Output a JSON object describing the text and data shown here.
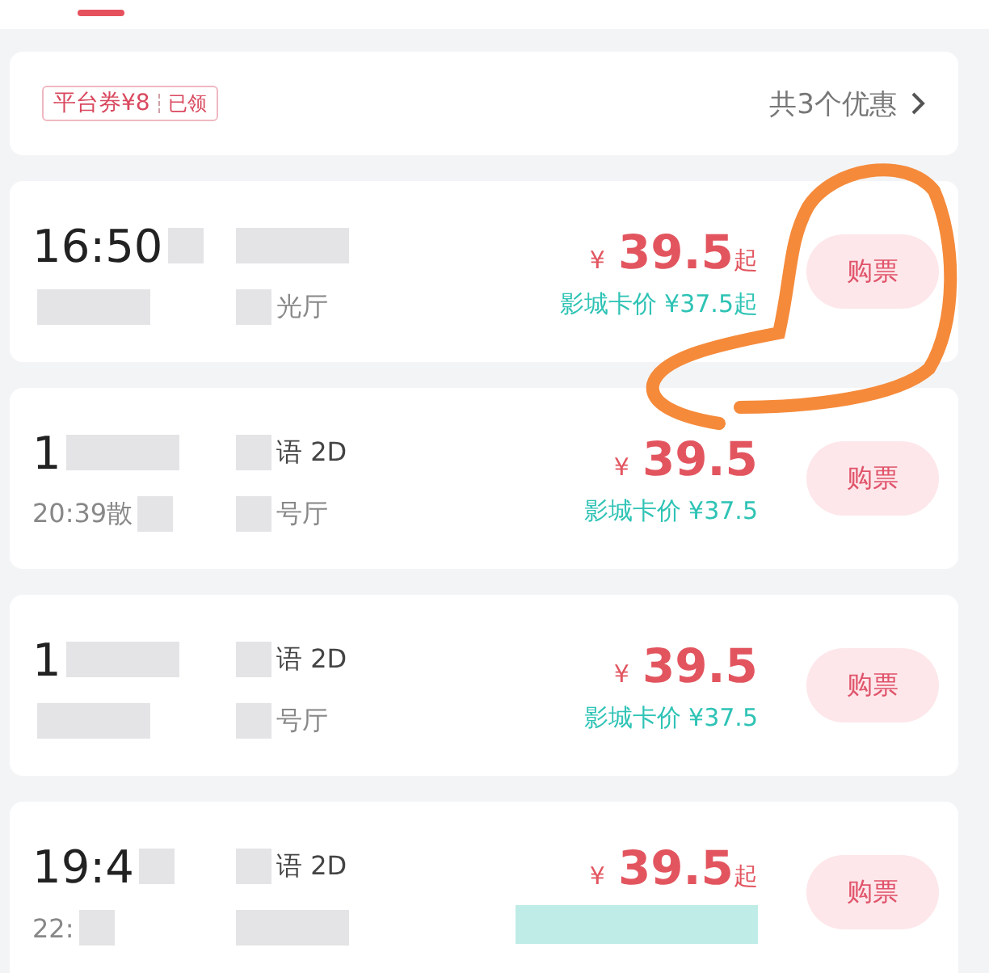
{
  "coupon_bar": {
    "coupon": "平台券¥8",
    "coupon_status": "已领",
    "offers_link": "共3个优惠"
  },
  "showtimes": [
    {
      "start": "16:50",
      "hall": "光厅",
      "currency": "¥",
      "price": "39.5",
      "price_suffix": "起",
      "card_price": "影城卡价 ¥37.5起",
      "button": "购票"
    },
    {
      "start": "1",
      "end": "20:39散",
      "format": "语 2D",
      "hall": "号厅",
      "currency": "¥",
      "price": "39.5",
      "card_price": "影城卡价 ¥37.5",
      "button": "购票"
    },
    {
      "start": "1",
      "format": "语 2D",
      "hall": "号厅",
      "currency": "¥",
      "price": "39.5",
      "card_price": "影城卡价 ¥37.5",
      "button": "购票"
    },
    {
      "start": "19:4",
      "end": "22:",
      "format": "语 2D",
      "currency": "¥",
      "price": "39.5",
      "price_suffix": "起",
      "button": "购票"
    }
  ]
}
